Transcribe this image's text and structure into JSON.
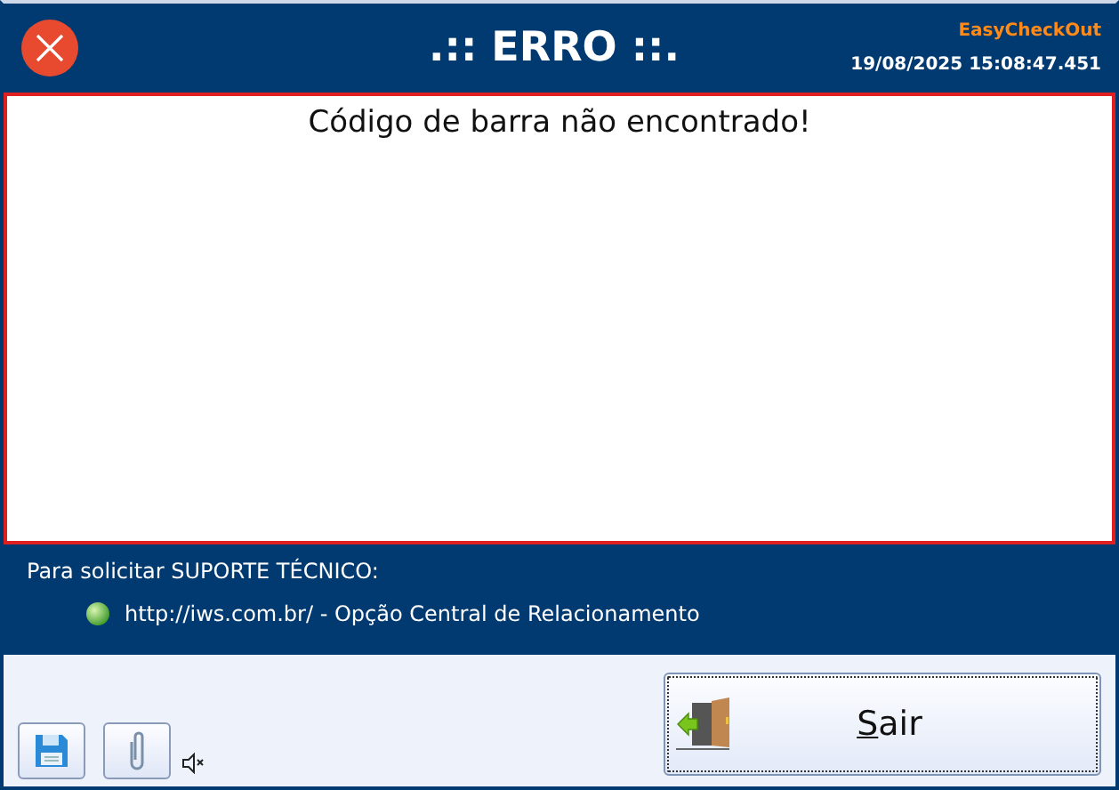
{
  "header": {
    "title": ".:: ERRO ::.",
    "app_name": "EasyCheckOut",
    "timestamp": "19/08/2025 15:08:47.451"
  },
  "message": "Código de barra não encontrado!",
  "support": {
    "heading": "Para solicitar SUPORTE TÉCNICO:",
    "link": "http://iws.com.br/",
    "link_note": " - Opção Central de Relacionamento"
  },
  "sound_muted": true,
  "exit_button": {
    "label": "Sair",
    "first_letter_underlined": true,
    "focused": true
  }
}
